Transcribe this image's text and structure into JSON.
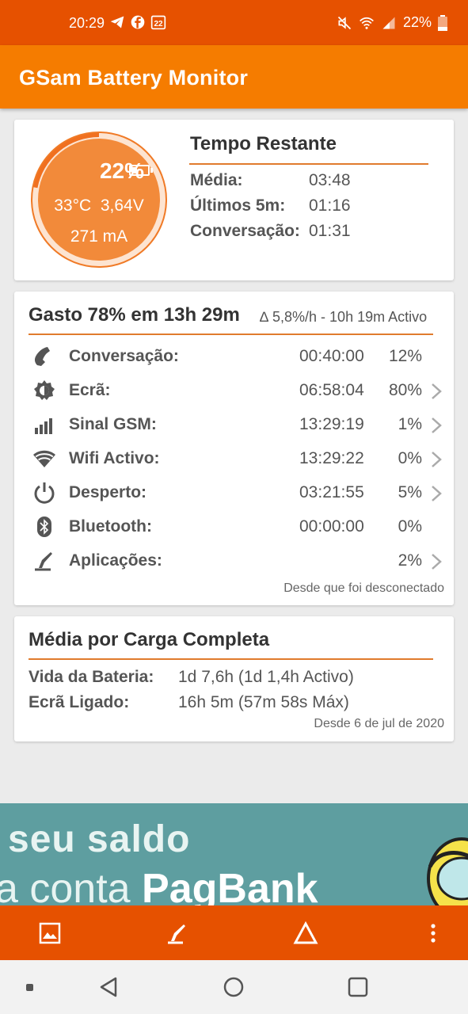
{
  "status_bar": {
    "time": "20:29",
    "notification_icons": [
      "telegram-icon",
      "facebook-icon",
      "calendar-22-icon"
    ],
    "battery": "22%",
    "right_icons": [
      "mute-icon",
      "wifi-icon",
      "signal-icon",
      "battery-icon"
    ]
  },
  "app_bar": {
    "title": "GSam Battery Monitor"
  },
  "battery_card": {
    "percent": "22%",
    "percent_value": 22,
    "temp_voltage": "33°C  3,64V",
    "current": "271 mA",
    "title": "Tempo Restante",
    "rows": [
      {
        "label": "Média:",
        "value": "03:48"
      },
      {
        "label": "Últimos 5m:",
        "value": "01:16"
      },
      {
        "label": "Conversação:",
        "value": "01:31"
      }
    ]
  },
  "usage_card": {
    "title": "Gasto 78% em 13h 29m",
    "subtitle": "∆ 5,8%/h - 10h 19m Activo",
    "rows": [
      {
        "icon": "phone-icon",
        "label": "Conversação:",
        "time": "00:40:00",
        "pct": "12%",
        "chevron": false
      },
      {
        "icon": "brightness-icon",
        "label": "Ecrã:",
        "time": "06:58:04",
        "pct": "80%",
        "chevron": true
      },
      {
        "icon": "signal-bars-icon",
        "label": "Sinal GSM:",
        "time": "13:29:19",
        "pct": "1%",
        "chevron": true
      },
      {
        "icon": "wifi-icon",
        "label": "Wifi Activo:",
        "time": "13:29:22",
        "pct": "0%",
        "chevron": true
      },
      {
        "icon": "power-icon",
        "label": "Desperto:",
        "time": "03:21:55",
        "pct": "5%",
        "chevron": true
      },
      {
        "icon": "bluetooth-icon",
        "label": "Bluetooth:",
        "time": "00:00:00",
        "pct": "0%",
        "chevron": false
      },
      {
        "icon": "apps-brush-icon",
        "label": "Aplicações:",
        "time": "",
        "pct": "2%",
        "chevron": true
      }
    ],
    "footnote": "Desde que foi desconectado"
  },
  "average_card": {
    "title": "Média por Carga Completa",
    "rows": [
      {
        "label": "Vida da Bateria:",
        "value": "1d 7,6h (1d 1,4h Activo)"
      },
      {
        "label": "Ecrã Ligado:",
        "value": "16h 5m (57m 58s Máx)"
      }
    ],
    "footnote": "Desde 6 de jul de 2020"
  },
  "ad": {
    "line1": "seu saldo",
    "line2_prefix": "a conta ",
    "line2_brand": "PagBank"
  },
  "bottom_bar": {
    "buttons": [
      "image-icon",
      "brush-icon",
      "delta-icon",
      "more-vert-icon"
    ]
  },
  "nav_bar": {
    "buttons": [
      "recents-dot-icon",
      "back-icon",
      "home-icon",
      "overview-icon"
    ]
  },
  "colors": {
    "status_bar": "#e65100",
    "app_bar": "#f57c00",
    "accent_line": "#e07b2d",
    "gauge": "#f28a3a"
  }
}
